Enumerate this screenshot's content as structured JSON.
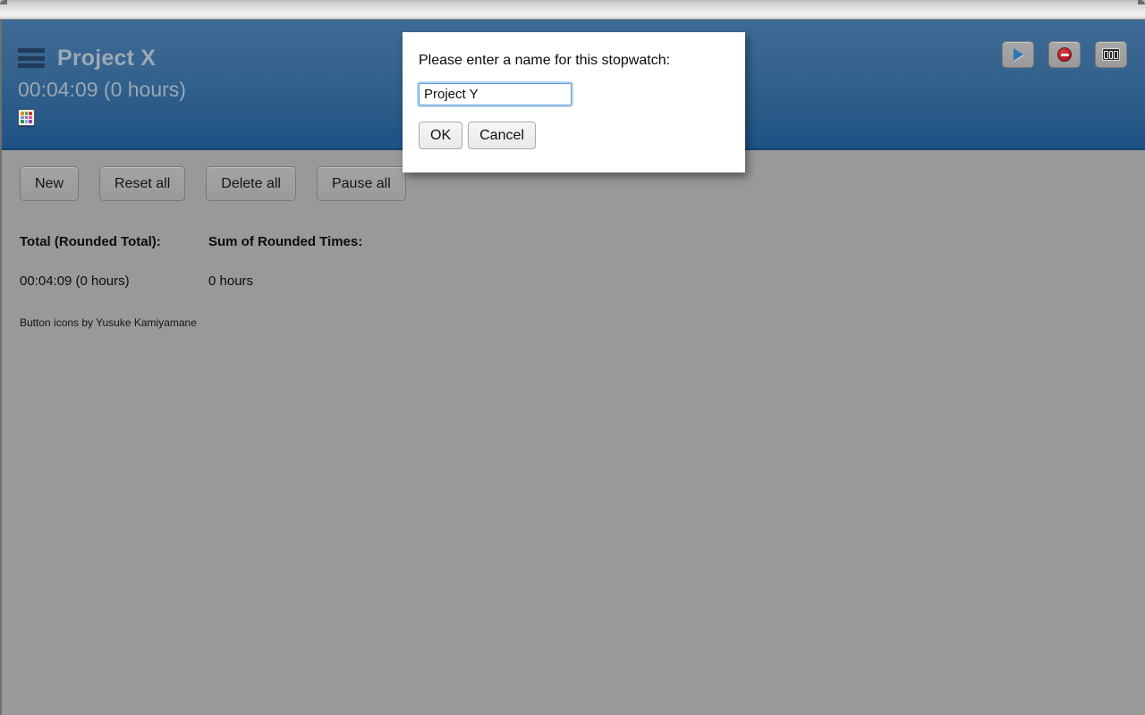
{
  "header": {
    "menu_icon": "hamburger-menu-icon",
    "title": "Project X",
    "elapsed": "00:04:09 (0 hours)",
    "palette_icon": "color-palette-icon",
    "palette_colors": [
      "#d98a2b",
      "#4fa04f",
      "#c0392b",
      "#5b9bd5",
      "#9b59b6",
      "#e74c8c",
      "#2e8b57",
      "#7fb3d5",
      "#8e44ad"
    ],
    "actions": [
      {
        "name": "start-button",
        "icon": "play-icon",
        "label": ""
      },
      {
        "name": "stop-button",
        "icon": "stop-circle-icon",
        "label": ""
      },
      {
        "name": "counter-button",
        "icon": "counter-icon",
        "label": "000"
      }
    ]
  },
  "toolbar": {
    "buttons": [
      {
        "label": "New",
        "name": "new-button"
      },
      {
        "label": "Reset all",
        "name": "reset-all-button"
      },
      {
        "label": "Delete all",
        "name": "delete-all-button"
      },
      {
        "label": "Pause all",
        "name": "pause-all-button"
      }
    ]
  },
  "totals": {
    "total_label": "Total (Rounded Total):",
    "total_value": "00:04:09 (0 hours)",
    "sum_label": "Sum of Rounded Times:",
    "sum_value": "0 hours"
  },
  "credit": "Button icons by Yusuke Kamiyamane",
  "dialog": {
    "message": "Please enter a name for this stopwatch:",
    "input_value": "Project Y",
    "input_placeholder": "",
    "ok_label": "OK",
    "cancel_label": "Cancel"
  },
  "colors": {
    "header_top": "#3d6b96",
    "header_bottom": "#1e5285",
    "page_background": "#999999",
    "title_text": "#9ca9b4",
    "accent_blue": "#2e77b5",
    "stop_red": "#bb1f2c",
    "focus_ring": "#b6d4ee"
  }
}
